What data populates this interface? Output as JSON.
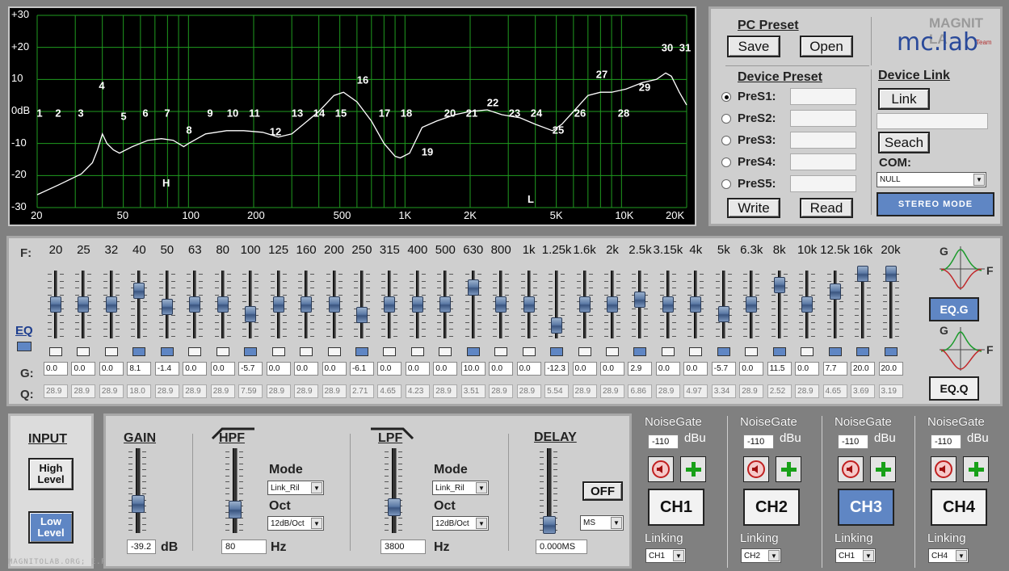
{
  "graph": {
    "y_labels": [
      "+30",
      "+20",
      "10",
      "0dB",
      "-10",
      "-20",
      "-30"
    ],
    "x_labels": [
      "20",
      "50",
      "100",
      "200",
      "500",
      "1K",
      "2K",
      "5K",
      "10K",
      "20K"
    ],
    "band_numbers": [
      "1",
      "2",
      "3",
      "4",
      "5",
      "6",
      "7",
      "8",
      "9",
      "10",
      "11",
      "12",
      "13",
      "14",
      "15",
      "16",
      "17",
      "18",
      "19",
      "20",
      "21",
      "22",
      "23",
      "24",
      "25",
      "26",
      "27",
      "28",
      "29",
      "30",
      "31"
    ],
    "h_marker": "H",
    "l_marker": "L"
  },
  "preset": {
    "pc_title": "PC Preset",
    "save": "Save",
    "open": "Open",
    "device_title": "Device Preset",
    "presets": [
      "PreS1:",
      "PreS2:",
      "PreS3:",
      "PreS4:",
      "PreS5:"
    ],
    "selected": 0,
    "write": "Write",
    "read": "Read",
    "link_title": "Device  Link",
    "link": "Link",
    "seach": "Seach",
    "com_label": "COM:",
    "com_value": "NULL",
    "stereo": "STEREO MODE",
    "logo_top": "MAGNIT LA",
    "logo_main": "mc.lab",
    "logo_sub": "Team"
  },
  "eq": {
    "f_label": "F:",
    "g_label": "G:",
    "q_label": "Q:",
    "eq_label": "EQ",
    "freqs": [
      "20",
      "25",
      "32",
      "40",
      "50",
      "63",
      "80",
      "100",
      "125",
      "160",
      "200",
      "250",
      "315",
      "400",
      "500",
      "630",
      "800",
      "1k",
      "1.25k",
      "1.6k",
      "2k",
      "2.5k",
      "3.15k",
      "4k",
      "5k",
      "6.3k",
      "8k",
      "10k",
      "12.5k",
      "16k",
      "20k"
    ],
    "gains": [
      "0.0",
      "0.0",
      "0.0",
      "8.1",
      "-1.4",
      "0.0",
      "0.0",
      "-5.7",
      "0.0",
      "0.0",
      "0.0",
      "-6.1",
      "0.0",
      "0.0",
      "0.0",
      "10.0",
      "0.0",
      "0.0",
      "-12.3",
      "0.0",
      "0.0",
      "2.9",
      "0.0",
      "0.0",
      "-5.7",
      "0.0",
      "11.5",
      "0.0",
      "7.7",
      "20.0",
      "20.0"
    ],
    "qs": [
      "28.9",
      "28.9",
      "28.9",
      "18.0",
      "28.9",
      "28.9",
      "28.9",
      "7.59",
      "28.9",
      "28.9",
      "28.9",
      "2.71",
      "4.65",
      "4.23",
      "28.9",
      "3.51",
      "28.9",
      "28.9",
      "5.54",
      "28.9",
      "28.9",
      "6.86",
      "28.9",
      "4.97",
      "3.34",
      "28.9",
      "2.52",
      "28.9",
      "4.65",
      "3.69",
      "3.19"
    ],
    "leds": [
      0,
      0,
      0,
      1,
      1,
      0,
      0,
      1,
      0,
      0,
      0,
      1,
      0,
      0,
      0,
      1,
      0,
      0,
      1,
      0,
      0,
      1,
      0,
      0,
      1,
      0,
      1,
      0,
      1,
      1,
      1
    ],
    "eqg": "EQ.G",
    "eqq": "EQ.Q",
    "g_axis": "G",
    "f_axis": "F"
  },
  "input": {
    "title": "INPUT",
    "high": "High Level",
    "low": "Low Level"
  },
  "gain": {
    "title": "GAIN",
    "value": "-39.2",
    "unit": "dB"
  },
  "hpf": {
    "title": "HPF",
    "mode_label": "Mode",
    "mode": "Link_Ril",
    "oct_label": "Oct",
    "oct": "12dB/Oct",
    "freq": "80",
    "unit": "Hz"
  },
  "lpf": {
    "title": "LPF",
    "mode_label": "Mode",
    "mode": "Link_Ril",
    "oct_label": "Oct",
    "oct": "12dB/Oct",
    "freq": "3800",
    "unit": "Hz"
  },
  "delay": {
    "title": "DELAY",
    "off": "OFF",
    "unit_sel": "MS",
    "value": "0.000MS"
  },
  "channels": [
    {
      "ng": "NoiseGate",
      "db_value": "-110",
      "dbu": "dBu",
      "name": "CH1",
      "linking": "Linking",
      "link": "CH1",
      "active": false
    },
    {
      "ng": "NoiseGate",
      "db_value": "-110",
      "dbu": "dBu",
      "name": "CH2",
      "linking": "Linking",
      "link": "CH2",
      "active": false
    },
    {
      "ng": "NoiseGate",
      "db_value": "-110",
      "dbu": "dBu",
      "name": "CH3",
      "linking": "Linking",
      "link": "CH1",
      "active": true
    },
    {
      "ng": "NoiseGate",
      "db_value": "-110",
      "dbu": "dBu",
      "name": "CH4",
      "linking": "Linking",
      "link": "CH4",
      "active": false
    }
  ],
  "watermark": "MAGNITOLAB.ORG; E.RU; (.NET)",
  "colors": {
    "accent": "#5f86c4",
    "curve": "#ffffff",
    "grid": "#1f9b1f"
  }
}
